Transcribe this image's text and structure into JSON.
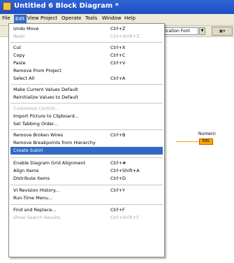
{
  "window": {
    "title": "Untitled 6 Block Diagram *"
  },
  "menubar": {
    "items": [
      "File",
      "Edit",
      "View",
      "Project",
      "Operate",
      "Tools",
      "Window",
      "Help"
    ]
  },
  "toolbar": {
    "font_value": "lication Font",
    "align_icon": "align-icon"
  },
  "canvas": {
    "terminal_label": "Numeric",
    "terminal_text": "DBL"
  },
  "edit_menu": {
    "items": [
      {
        "label": "Undo Move",
        "shortcut": "Ctrl+Z",
        "enabled": true
      },
      {
        "label": "Redo",
        "shortcut": "Ctrl+Shift+Z",
        "enabled": false
      },
      {
        "label": "Cut",
        "shortcut": "Ctrl+X",
        "enabled": true
      },
      {
        "label": "Copy",
        "shortcut": "Ctrl+C",
        "enabled": true
      },
      {
        "label": "Paste",
        "shortcut": "Ctrl+V",
        "enabled": true
      },
      {
        "label": "Remove From Project",
        "shortcut": "",
        "enabled": true
      },
      {
        "label": "Select All",
        "shortcut": "Ctrl+A",
        "enabled": true
      },
      {
        "label": "Make Current Values Default",
        "shortcut": "",
        "enabled": true
      },
      {
        "label": "Reinitialize Values to Default",
        "shortcut": "",
        "enabled": true
      },
      {
        "label": "Customize Control...",
        "shortcut": "",
        "enabled": false
      },
      {
        "label": "Import Picture to Clipboard...",
        "shortcut": "",
        "enabled": true
      },
      {
        "label": "Set Tabbing Order...",
        "shortcut": "",
        "enabled": true
      },
      {
        "label": "Remove Broken Wires",
        "shortcut": "Ctrl+B",
        "enabled": true
      },
      {
        "label": "Remove Breakpoints from Hierarchy",
        "shortcut": "",
        "enabled": true
      },
      {
        "label": "Create SubVI",
        "shortcut": "",
        "enabled": true,
        "highlighted": true
      },
      {
        "label": "Enable Diagram Grid Alignment",
        "shortcut": "Ctrl+#",
        "enabled": true
      },
      {
        "label": "Align Items",
        "shortcut": "Ctrl+Shift+A",
        "enabled": true
      },
      {
        "label": "Distribute Items",
        "shortcut": "Ctrl+D",
        "enabled": true
      },
      {
        "label": "VI Revision History...",
        "shortcut": "Ctrl+Y",
        "enabled": true
      },
      {
        "label": "Run-Time Menu...",
        "shortcut": "",
        "enabled": true
      },
      {
        "label": "Find and Replace...",
        "shortcut": "Ctrl+F",
        "enabled": true
      },
      {
        "label": "Show Search Results",
        "shortcut": "Ctrl+Shift+F",
        "enabled": false
      }
    ]
  }
}
